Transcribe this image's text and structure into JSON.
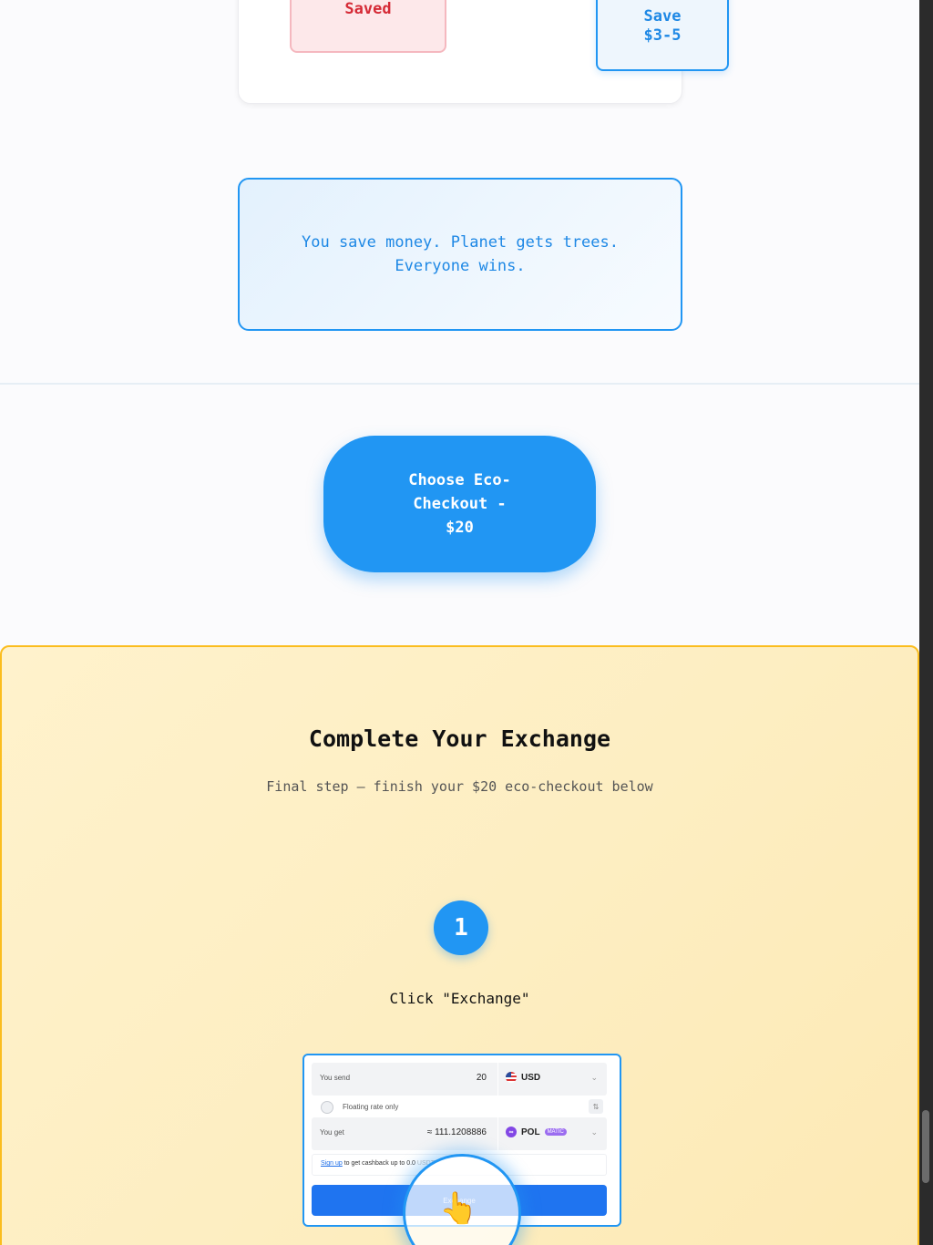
{
  "comparison": {
    "saved_label": "Saved",
    "save_label_line1": "Save",
    "save_label_line2": "$3-5"
  },
  "quote": {
    "text_line1": "You save money. Planet gets trees.",
    "text_line2": "Everyone wins."
  },
  "cta": {
    "line1": "Choose Eco-",
    "line2": "Checkout -",
    "line3": "$20"
  },
  "exchange_section": {
    "title": "Complete Your Exchange",
    "subtitle": "Final step – finish your $20 eco-checkout below",
    "step_number": "1",
    "step_label": "Click \"Exchange\""
  },
  "widget": {
    "send_label": "You send",
    "send_amount": "20",
    "send_currency": "USD",
    "floating_text": "Floating rate only",
    "get_label": "You get",
    "get_amount": "≈ 111.1208886",
    "get_currency": "POL",
    "get_badge": "MATIC",
    "cashback_link": "Sign up",
    "cashback_text": "to get cashback up to 0.0",
    "cashback_tail": "USDT",
    "exchange_button": "Exchange"
  },
  "icons": {
    "send_flag": "us-flag-icon",
    "get_coin": "polygon-icon",
    "chevron": "chevron-down-icon",
    "swap": "swap-icon",
    "pointer": "pointing-hand-icon"
  },
  "colors": {
    "accent": "#2196f3",
    "saved_red": "#d52a36",
    "section_border": "#fbbd1e",
    "section_bg": "#fff2cc"
  }
}
